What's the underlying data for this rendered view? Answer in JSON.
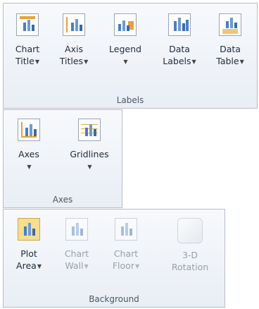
{
  "labels_group": {
    "caption": "Labels",
    "buttons": [
      {
        "line1": "Chart",
        "line2": "Title",
        "icon": "chart-title-icon"
      },
      {
        "line1": "Axis",
        "line2": "Titles",
        "icon": "axis-titles-icon"
      },
      {
        "line1": "Legend",
        "line2": "",
        "icon": "legend-icon"
      },
      {
        "line1": "Data",
        "line2": "Labels",
        "icon": "data-labels-icon"
      },
      {
        "line1": "Data",
        "line2": "Table",
        "icon": "data-table-icon"
      }
    ]
  },
  "axes_group": {
    "caption": "Axes",
    "buttons": [
      {
        "line1": "Axes",
        "line2": "",
        "icon": "axes-icon"
      },
      {
        "line1": "Gridlines",
        "line2": "",
        "icon": "gridlines-icon"
      }
    ]
  },
  "background_group": {
    "caption": "Background",
    "buttons": [
      {
        "line1": "Plot",
        "line2": "Area",
        "icon": "plot-area-icon",
        "enabled": true
      },
      {
        "line1": "Chart",
        "line2": "Wall",
        "icon": "chart-wall-icon",
        "enabled": false
      },
      {
        "line1": "Chart",
        "line2": "Floor",
        "icon": "chart-floor-icon",
        "enabled": false
      },
      {
        "line1": "3-D",
        "line2": "Rotation",
        "icon": "3d-rotation-icon",
        "enabled": false
      }
    ]
  },
  "colors": {
    "accent_orange": "#e6a23a",
    "bar_blue": "#4a7ec2",
    "selected_fill": "#f6dd8f"
  }
}
